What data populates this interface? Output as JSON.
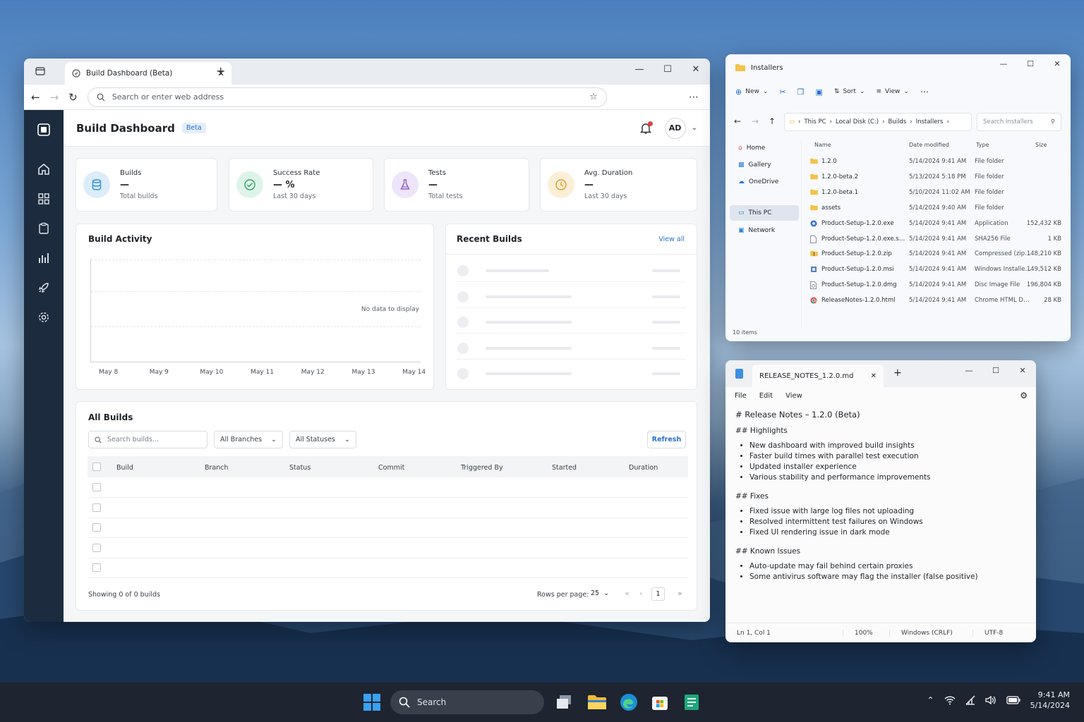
{
  "browser": {
    "tab_title": "Build Dashboard (Beta)",
    "url_placeholder": "Search or enter web address"
  },
  "dashboard": {
    "title": "Build Dashboard",
    "badge": "Beta",
    "avatar": "AD",
    "stats": [
      {
        "title": "Builds",
        "value": "—",
        "sub": "Total builds",
        "icon": "database-icon",
        "color": "#2f8fd8",
        "bg": "#dcecfb"
      },
      {
        "title": "Success Rate",
        "value": "— %",
        "sub": "Last 30 days",
        "icon": "check-circle-icon",
        "color": "#2ea36b",
        "bg": "#dff4e9"
      },
      {
        "title": "Tests",
        "value": "—",
        "sub": "Total tests",
        "icon": "flask-icon",
        "color": "#8b5cc9",
        "bg": "#eee5fa"
      },
      {
        "title": "Avg. Duration",
        "value": "—",
        "sub": "Last 30 days",
        "icon": "clock-icon",
        "color": "#e39a1d",
        "bg": "#fcefd8"
      }
    ],
    "activity": {
      "title": "Build Activity",
      "empty": "No data to display",
      "x_labels": [
        "May 8",
        "May 9",
        "May 10",
        "May 11",
        "May 12",
        "May 13",
        "May 14"
      ]
    },
    "recent": {
      "title": "Recent Builds",
      "view_all": "View all"
    },
    "all_builds": {
      "title": "All Builds",
      "search_placeholder": "Search builds...",
      "branches": "All Branches",
      "statuses": "All Statuses",
      "refresh": "Refresh",
      "columns": [
        "Build",
        "Branch",
        "Status",
        "Commit",
        "Triggered By",
        "Started",
        "Duration"
      ],
      "showing": "Showing 0 of 0 builds",
      "rows_label": "Rows per page:",
      "rows_value": "25",
      "page": "1"
    }
  },
  "explorer": {
    "title": "Installers",
    "toolbar": {
      "new": "New",
      "sort": "Sort",
      "view": "View"
    },
    "breadcrumb": [
      "This PC",
      "Local Disk (C:)",
      "Builds",
      "Installers"
    ],
    "search_placeholder": "Search Installers",
    "nav": [
      "Home",
      "Gallery",
      "OneDrive",
      "This PC",
      "Network"
    ],
    "columns": [
      "Name",
      "Date modified",
      "Type",
      "Size"
    ],
    "files": [
      {
        "name": "1.2.0",
        "date": "5/14/2024 9:41 AM",
        "type": "File folder",
        "size": "",
        "icon": "folder-icon"
      },
      {
        "name": "1.2.0-beta.2",
        "date": "5/13/2024 5:18 PM",
        "type": "File folder",
        "size": "",
        "icon": "folder-icon"
      },
      {
        "name": "1.2.0-beta.1",
        "date": "5/10/2024 11:02 AM",
        "type": "File folder",
        "size": "",
        "icon": "folder-icon"
      },
      {
        "name": "assets",
        "date": "5/14/2024 9:40 AM",
        "type": "File folder",
        "size": "",
        "icon": "folder-icon"
      },
      {
        "name": "Product-Setup-1.2.0.exe",
        "date": "5/14/2024 9:41 AM",
        "type": "Application",
        "size": "152,432 KB",
        "icon": "exe-icon"
      },
      {
        "name": "Product-Setup-1.2.0.exe.sha256",
        "date": "5/14/2024 9:41 AM",
        "type": "SHA256 File",
        "size": "1 KB",
        "icon": "file-icon"
      },
      {
        "name": "Product-Setup-1.2.0.zip",
        "date": "5/14/2024 9:41 AM",
        "type": "Compressed (zipp...",
        "size": "148,210 KB",
        "icon": "zip-icon"
      },
      {
        "name": "Product-Setup-1.2.0.msi",
        "date": "5/14/2024 9:41 AM",
        "type": "Windows Installer ...",
        "size": "149,512 KB",
        "icon": "msi-icon"
      },
      {
        "name": "Product-Setup-1.2.0.dmg",
        "date": "5/14/2024 9:41 AM",
        "type": "Disc Image File",
        "size": "196,804 KB",
        "icon": "disc-icon"
      },
      {
        "name": "ReleaseNotes-1.2.0.html",
        "date": "5/14/2024 9:41 AM",
        "type": "Chrome HTML Do...",
        "size": "28 KB",
        "icon": "chrome-icon"
      }
    ],
    "status": "10 items"
  },
  "notepad": {
    "tab_title": "RELEASE_NOTES_1.2.0.md",
    "menu": [
      "File",
      "Edit",
      "View"
    ],
    "heading": "# Release Notes – 1.2.0 (Beta)",
    "sections": [
      {
        "title": "## Highlights",
        "items": [
          "New dashboard with improved build insights",
          "Faster build times with parallel test execution",
          "Updated installer experience",
          "Various stability and performance improvements"
        ]
      },
      {
        "title": "## Fixes",
        "items": [
          "Fixed issue with large log files not uploading",
          "Resolved intermittent test failures on Windows",
          "Fixed UI rendering issue in dark mode"
        ]
      },
      {
        "title": "## Known Issues",
        "items": [
          "Auto-update may fail behind certain proxies",
          "Some antivirus software may flag the installer (false positive)"
        ]
      }
    ],
    "status": {
      "position": "Ln 1, Col 1",
      "zoom": "100%",
      "eol": "Windows (CRLF)",
      "encoding": "UTF-8"
    }
  },
  "taskbar": {
    "search": "Search",
    "time": "9:41 AM",
    "date": "5/14/2024"
  }
}
